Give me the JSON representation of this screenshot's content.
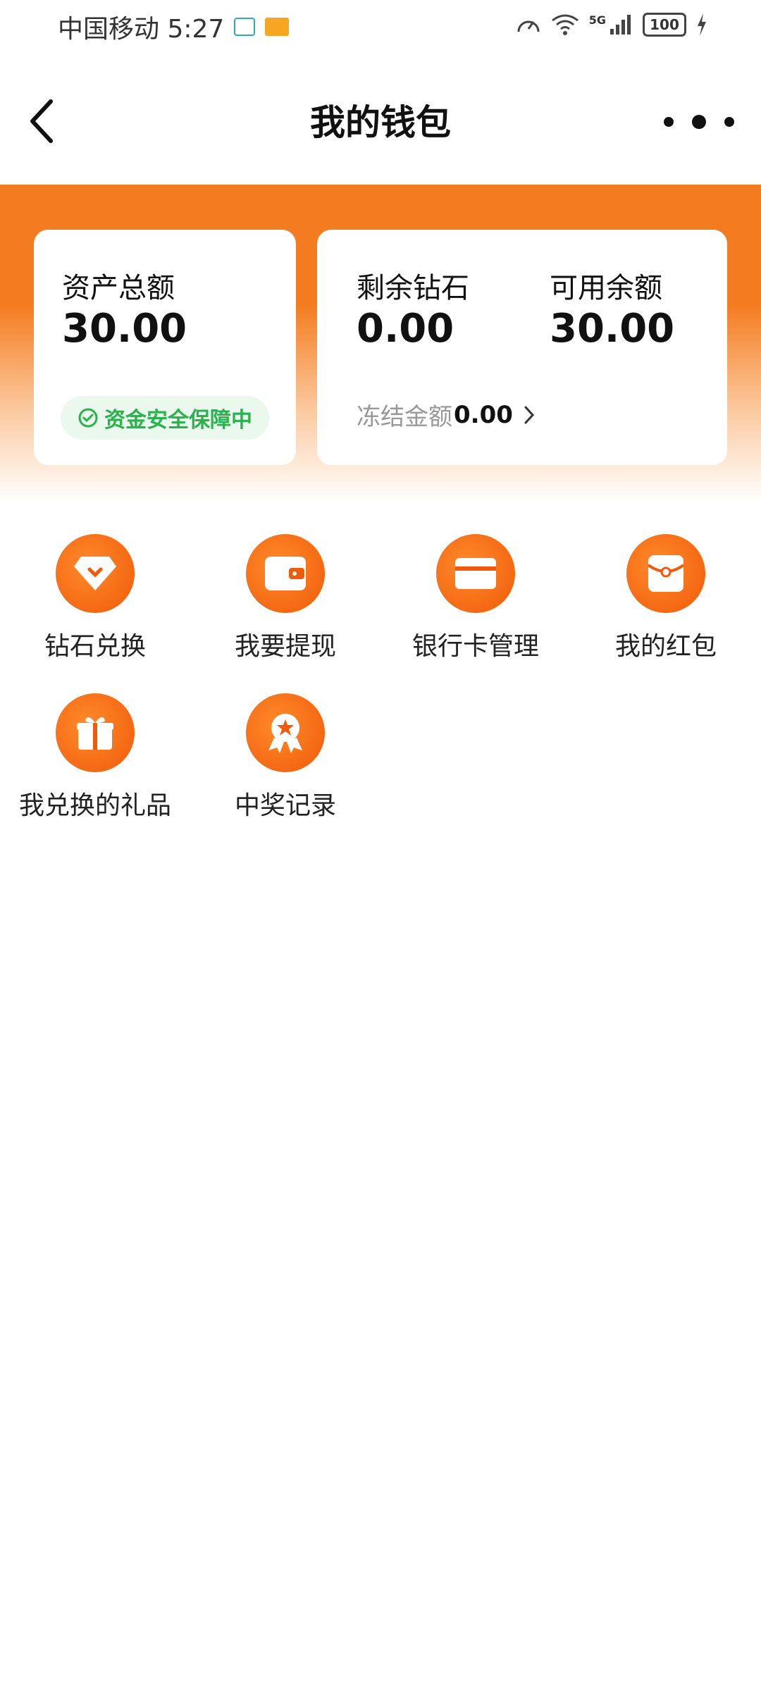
{
  "status_bar": {
    "carrier_time": "中国移动 5:27",
    "network": "5G",
    "battery": "100"
  },
  "navbar": {
    "title": "我的钱包"
  },
  "cards": {
    "total_assets": {
      "label": "资产总额",
      "value": "30.00",
      "badge": "资金安全保障中"
    },
    "diamonds": {
      "label": "剩余钻石",
      "value": "0.00"
    },
    "available": {
      "label": "可用余额",
      "value": "30.00"
    },
    "frozen": {
      "label": "冻结金额",
      "value": "0.00"
    }
  },
  "features": [
    {
      "label": "钻石兑换",
      "icon": "diamond-icon"
    },
    {
      "label": "我要提现",
      "icon": "wallet-icon"
    },
    {
      "label": "银行卡管理",
      "icon": "bank-card-icon"
    },
    {
      "label": "我的红包",
      "icon": "red-envelope-icon"
    },
    {
      "label": "我兑换的礼品",
      "icon": "gift-icon"
    },
    {
      "label": "中奖记录",
      "icon": "award-icon"
    }
  ],
  "colors": {
    "accent": "#f47c20",
    "safe": "#2bb24c"
  }
}
